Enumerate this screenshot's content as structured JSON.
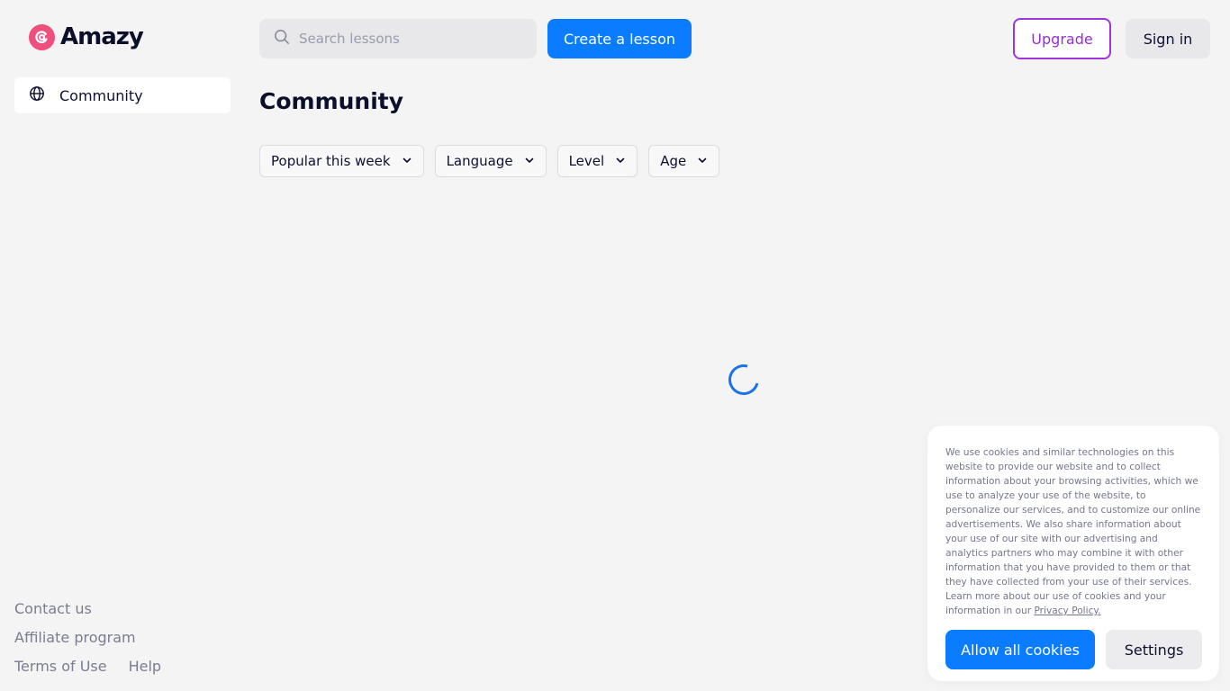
{
  "brand": {
    "name": "Amazy",
    "accent": "#ee4f7c"
  },
  "sidebar": {
    "items": [
      {
        "label": "Community",
        "icon": "globe-icon"
      }
    ],
    "footer": {
      "contact": "Contact us",
      "affiliate": "Affiliate program",
      "terms": "Terms of Use",
      "help": "Help"
    }
  },
  "header": {
    "search_placeholder": "Search lessons",
    "create_label": "Create a lesson",
    "upgrade_label": "Upgrade",
    "signin_label": "Sign in"
  },
  "main": {
    "title": "Community",
    "filters": [
      {
        "label": "Popular this week"
      },
      {
        "label": "Language"
      },
      {
        "label": "Level"
      },
      {
        "label": "Age"
      }
    ]
  },
  "cookie": {
    "text": "We use cookies and similar technologies on this website to provide our website and to collect information about your browsing activities, which we use to analyze your use of the website, to personalize our services, and to customize our online advertisements. We also share information about your use of our site with our advertising and analytics partners who may combine it with other information that you have provided to them or that they have collected from your use of their services. Learn more about our use of cookies and your information in our",
    "link": "Privacy Policy.",
    "allow_label": "Allow all cookies",
    "settings_label": "Settings"
  },
  "colors": {
    "primary": "#0a7cff",
    "upgrade": "#a233dc"
  }
}
